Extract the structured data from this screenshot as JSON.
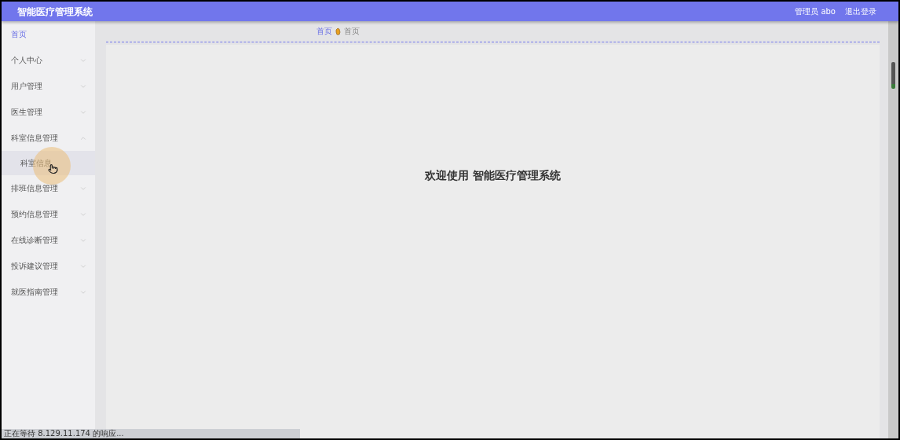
{
  "header": {
    "title": "智能医疗管理系统",
    "user": "管理员 abo",
    "logout": "退出登录"
  },
  "sidebar": {
    "items": [
      {
        "label": "首页",
        "kind": "link",
        "selected": true
      },
      {
        "label": "个人中心",
        "kind": "submenu",
        "selected": false,
        "expanded": false
      },
      {
        "label": "用户管理",
        "kind": "submenu",
        "selected": false,
        "expanded": false
      },
      {
        "label": "医生管理",
        "kind": "submenu",
        "selected": false,
        "expanded": false
      },
      {
        "label": "科室信息管理",
        "kind": "submenu",
        "selected": false,
        "expanded": true,
        "children": [
          {
            "label": "科室信息",
            "selected": false,
            "hovered": true
          }
        ]
      },
      {
        "label": "排班信息管理",
        "kind": "submenu",
        "selected": false,
        "expanded": false
      },
      {
        "label": "预约信息管理",
        "kind": "submenu",
        "selected": false,
        "expanded": false
      },
      {
        "label": "在线诊断管理",
        "kind": "submenu",
        "selected": false,
        "expanded": false
      },
      {
        "label": "投诉建议管理",
        "kind": "submenu",
        "selected": false,
        "expanded": false
      },
      {
        "label": "就医指南管理",
        "kind": "submenu",
        "selected": false,
        "expanded": false
      }
    ]
  },
  "breadcrumb": [
    {
      "label": "首页",
      "selected": false
    },
    {
      "label": "首页",
      "selected": true
    }
  ],
  "welcome": "欢迎使用 智能医疗管理系统",
  "status_bar": "正在等待 8.129.11.174 的响应..."
}
